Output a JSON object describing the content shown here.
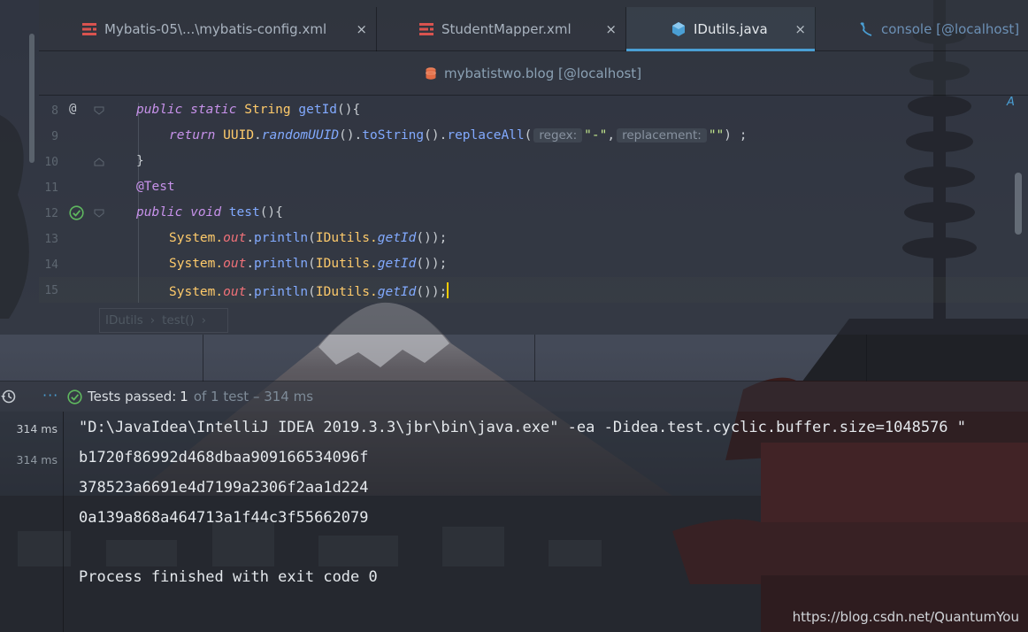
{
  "tabs": [
    {
      "label": "Mybatis-05\\...\\mybatis-config.xml",
      "icon": "xml-icon",
      "active": false
    },
    {
      "label": "StudentMapper.xml",
      "icon": "xml-icon",
      "active": false
    },
    {
      "label": "IDutils.java",
      "icon": "java-class-icon",
      "active": true
    },
    {
      "label": "console [@localhost]",
      "icon": "console-icon",
      "active": false
    }
  ],
  "close_glyph": "×",
  "datasource": {
    "label": "mybatistwo.blog [@localhost]",
    "icon": "database-icon"
  },
  "editor": {
    "line_numbers": [
      "8",
      "9",
      "10",
      "11",
      "12",
      "13",
      "14",
      "15"
    ],
    "line8": {
      "kw1": "public",
      "kw2": "static",
      "type": "String",
      "name": "getId",
      "rest": "(){"
    },
    "line9": {
      "kw": "return",
      "cls": "UUID",
      "m1": "randomUUID",
      "p1": "().",
      "m2": "toString",
      "p2": "().",
      "m3": "replaceAll",
      "p3": "(",
      "hint1": "regex:",
      "s1": "\"-\"",
      "comma": ",",
      "hint2": "replacement:",
      "s2": "\"\"",
      "end": ") ;"
    },
    "line10": "}",
    "line11": "@Test",
    "line12": {
      "kw1": "public",
      "kw2": "void",
      "name": "test",
      "rest": "(){"
    },
    "println_line": {
      "sys": "System.",
      "out": "out",
      "dot": ".",
      "pr": "println",
      "open": "(",
      "cls": "IDutils.",
      "m": "getId",
      "close": "());"
    },
    "breadcrumb": [
      "IDutils",
      "test()"
    ],
    "breadcrumb_sep": "›"
  },
  "run": {
    "status_label": "Tests passed:",
    "status_count": "1",
    "status_rest": "of 1 test – 314 ms",
    "more": "···"
  },
  "console": {
    "times": [
      "314 ms",
      "314 ms"
    ],
    "lines": [
      "\"D:\\JavaIdea\\IntelliJ IDEA 2019.3.3\\jbr\\bin\\java.exe\" -ea -Didea.test.cyclic.buffer.size=1048576 \"",
      "b1720f86992d468dbaa909166534096f",
      "378523a6691e4d7199a2306f2aa1d224",
      "0a139a868a464713a1f44c3f55662079",
      "",
      "Process finished with exit code 0"
    ]
  },
  "watermark": "https://blog.csdn.net/QuantumYou",
  "colors": {
    "accent": "#4a9fd4",
    "success": "#5fb85f",
    "keyword": "#c792ea",
    "function": "#82aaff",
    "type": "#ffcb6b",
    "string": "#c3e88d"
  }
}
